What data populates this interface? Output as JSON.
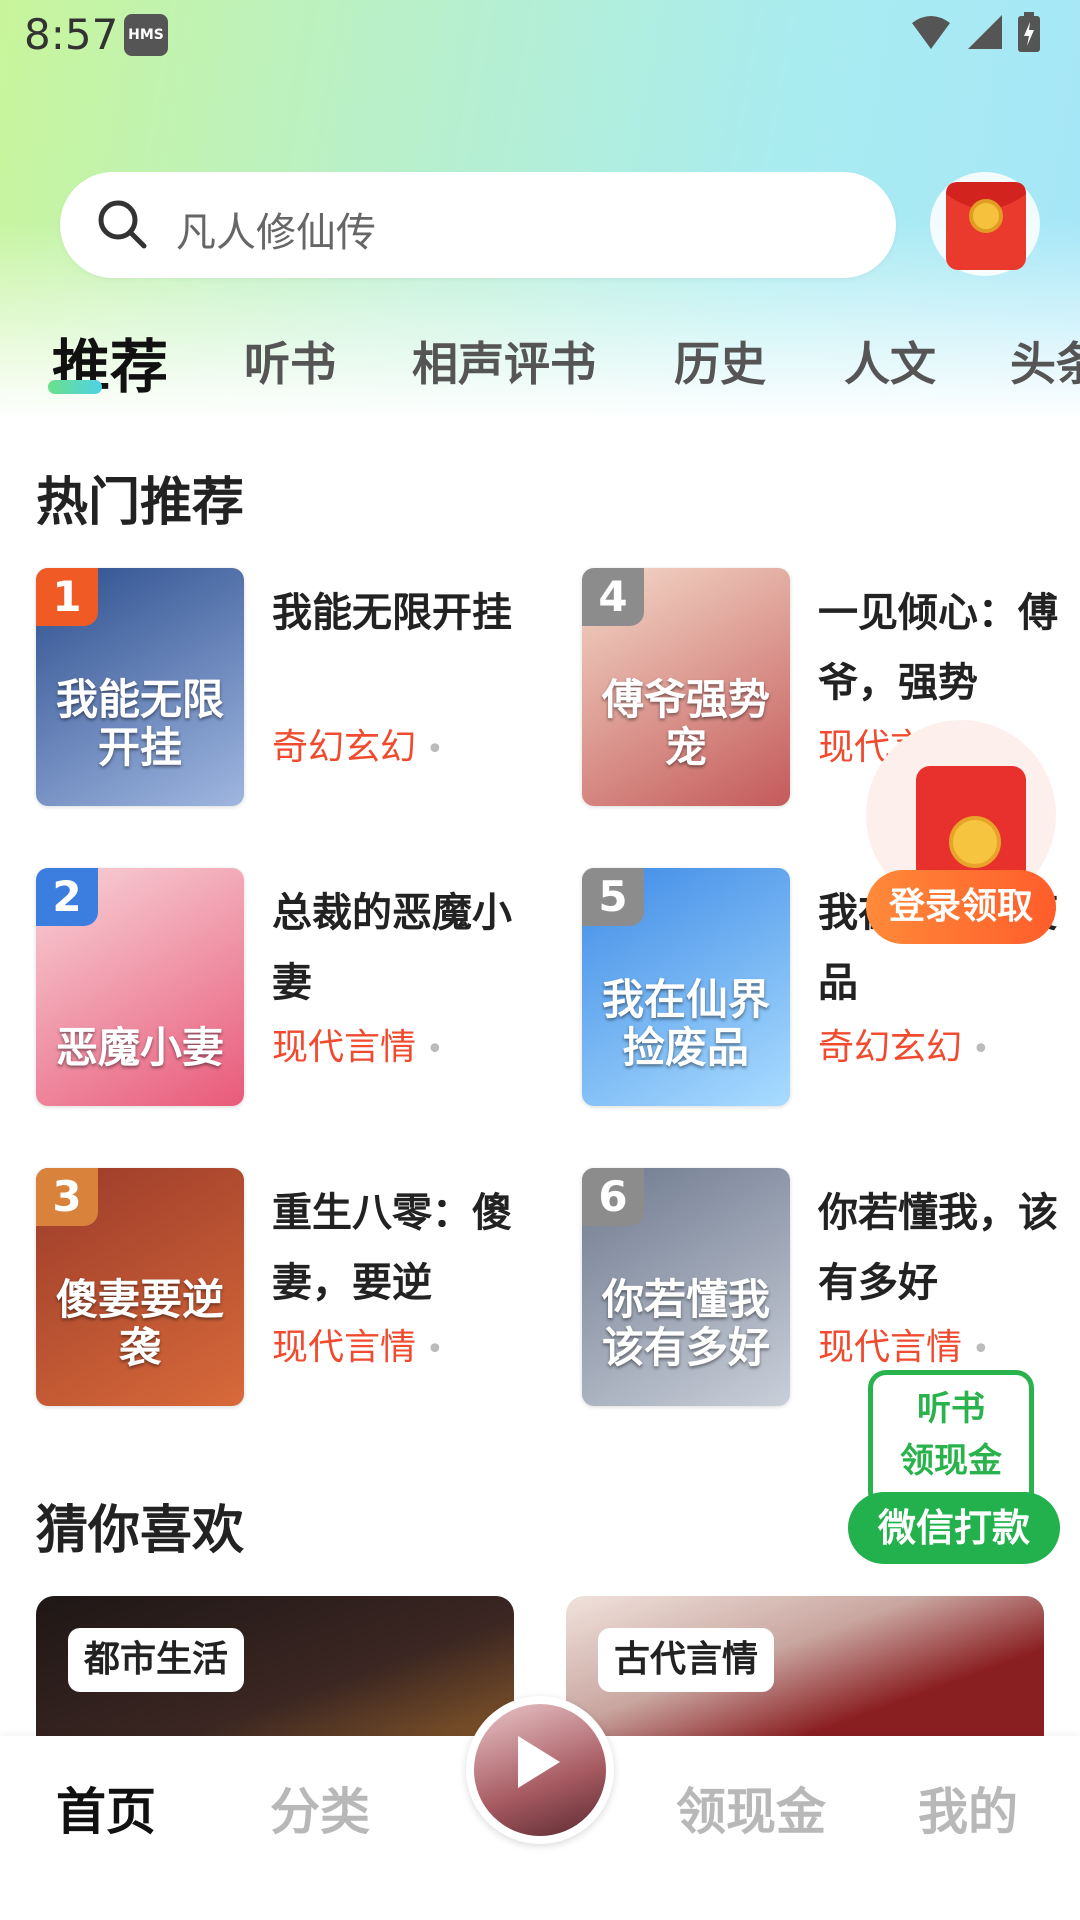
{
  "status_bar": {
    "time": "8:57",
    "badge": "HMS"
  },
  "search": {
    "placeholder": "凡人修仙传"
  },
  "tabs": [
    {
      "label": "推荐"
    },
    {
      "label": "听书"
    },
    {
      "label": "相声评书"
    },
    {
      "label": "历史"
    },
    {
      "label": "人文"
    },
    {
      "label": "头条"
    }
  ],
  "hot": {
    "title": "热门推荐",
    "books": [
      {
        "rank": "1",
        "title": "我能无限开挂",
        "genre": "奇幻玄幻",
        "cover_text": "我能无限开挂",
        "cover_colors": [
          "#2d4f8f",
          "#9fb6e0"
        ],
        "rank_color": "#f05a24"
      },
      {
        "rank": "2",
        "title": "总裁的恶魔小妻",
        "genre": "现代言情",
        "cover_text": "恶魔小妻",
        "cover_colors": [
          "#f7d3d8",
          "#e95a7a"
        ],
        "rank_color": "#3c7de0"
      },
      {
        "rank": "3",
        "title": "重生八零：傻妻，要逆",
        "genre": "现代言情",
        "cover_text": "傻妻要逆袭",
        "cover_colors": [
          "#9b3b2a",
          "#d86a3a"
        ],
        "rank_color": "#d8823c"
      },
      {
        "rank": "4",
        "title": "一见倾心：傅爷，强势",
        "genre": "现代言情",
        "cover_text": "傅爷强势宠",
        "cover_colors": [
          "#f4d9c9",
          "#c45a5a"
        ],
        "rank_color": "#8c8c8c"
      },
      {
        "rank": "5",
        "title": "我在仙界捡废品",
        "genre": "奇幻玄幻",
        "cover_text": "我在仙界捡废品",
        "cover_colors": [
          "#3f8be6",
          "#a9dcff"
        ],
        "rank_color": "#8c8c8c"
      },
      {
        "rank": "6",
        "title": "你若懂我，该有多好",
        "genre": "现代言情",
        "cover_text": "你若懂我该有多好",
        "cover_colors": [
          "#6f7a8f",
          "#c9cfd9"
        ],
        "rank_color": "#8c8c8c"
      }
    ]
  },
  "guess": {
    "title": "猜你喜欢",
    "cards": [
      {
        "tag": "都市生活",
        "bg": "#2a1f1d"
      },
      {
        "tag": "古代言情",
        "bg": "#8a1f22"
      }
    ]
  },
  "floats": {
    "login_label": "登录领取",
    "cash_line1": "听书",
    "cash_line2": "领现金",
    "cash_button": "微信打款"
  },
  "bottom_nav": {
    "home": "首页",
    "category": "分类",
    "cash": "领现金",
    "mine": "我的"
  }
}
